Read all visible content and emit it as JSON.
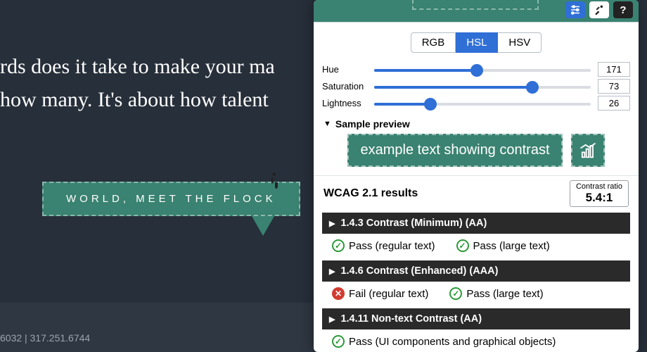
{
  "hero": {
    "line1": "rds does it take to make your ma",
    "line2": "how many. It's about how talent"
  },
  "cta": {
    "label": "WORLD, MEET THE FLOCK"
  },
  "footer": {
    "text": "6032 | 317.251.6744"
  },
  "panel": {
    "tabs": {
      "rgb": "RGB",
      "hsl": "HSL",
      "hsv": "HSV",
      "active": "hsl"
    },
    "sliders": {
      "hue": {
        "label": "Hue",
        "value": 171,
        "max": 360
      },
      "saturation": {
        "label": "Saturation",
        "value": 73,
        "max": 100
      },
      "lightness": {
        "label": "Lightness",
        "value": 26,
        "max": 100
      }
    },
    "preview": {
      "heading": "Sample preview",
      "text": "example text showing contrast"
    },
    "results": {
      "heading": "WCAG 2.1 results",
      "ratio_caption": "Contrast ratio",
      "ratio_value": "5.4:1",
      "criteria": [
        {
          "title": "1.4.3 Contrast (Minimum) (AA)",
          "items": [
            {
              "status": "pass",
              "label": "Pass (regular text)"
            },
            {
              "status": "pass",
              "label": "Pass (large text)"
            }
          ]
        },
        {
          "title": "1.4.6 Contrast (Enhanced) (AAA)",
          "items": [
            {
              "status": "fail",
              "label": "Fail (regular text)"
            },
            {
              "status": "pass",
              "label": "Pass (large text)"
            }
          ]
        },
        {
          "title": "1.4.11 Non-text Contrast (AA)",
          "items": [
            {
              "status": "pass",
              "label": "Pass (UI components and graphical objects)"
            }
          ]
        }
      ]
    }
  }
}
